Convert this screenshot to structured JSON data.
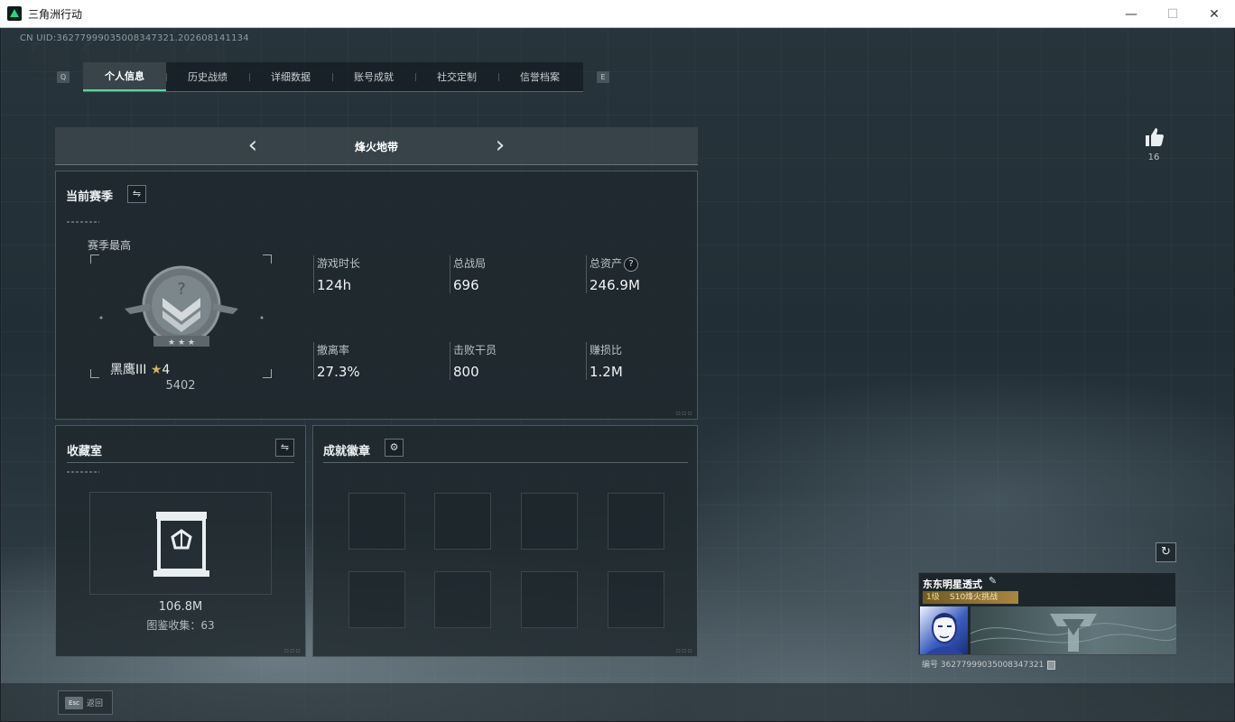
{
  "window": {
    "title": "三角洲行动",
    "minimize": "—",
    "maximize": "☐",
    "close": "✕"
  },
  "uid_line": "CN UID:3627799903500834​7321.202608141134",
  "tab_keys": {
    "left": "Q",
    "right": "E"
  },
  "tabs": [
    {
      "label": "个人信息",
      "active": true
    },
    {
      "label": "历史战绩",
      "active": false
    },
    {
      "label": "详细数据",
      "active": false
    },
    {
      "label": "账号成就",
      "active": false
    },
    {
      "label": "社交定制",
      "active": false
    },
    {
      "label": "信誉档案",
      "active": false
    }
  ],
  "mode": {
    "title": "烽火地带",
    "prev": "‹",
    "next": "›"
  },
  "season": {
    "title": "当前赛季",
    "switch_icon": "⇋",
    "best_label": "赛季最高",
    "rank_name": "黑鹰III",
    "rank_stars": "4",
    "rank_score": "5402",
    "stats": [
      {
        "label": "游戏时长",
        "value": "124h"
      },
      {
        "label": "总战局",
        "value": "696"
      },
      {
        "label": "总资产",
        "value": "246.9M",
        "help": "?"
      },
      {
        "label": "撤离率",
        "value": "27.3%"
      },
      {
        "label": "击败干员",
        "value": "800"
      },
      {
        "label": "赚损比",
        "value": "1.2M"
      }
    ]
  },
  "collection": {
    "title": "收藏室",
    "switch_icon": "⇋",
    "value": "106.8M",
    "count_label": "图鉴收集：63"
  },
  "badges": {
    "title": "成就徽章",
    "settings_icon": "⚙",
    "slots": 8
  },
  "likes": {
    "count": "16"
  },
  "profile": {
    "refresh_icon": "↻",
    "name": "东东明星透式",
    "edit_icon": "✎",
    "season_tag": "S10烽火挑战",
    "season_level": "1级",
    "id_line": "编号 36277999035008347321"
  },
  "esc": {
    "key": "Esc",
    "label": "返回"
  },
  "colors": {
    "accent": "#5fd3a0",
    "gold": "#a8873d"
  }
}
